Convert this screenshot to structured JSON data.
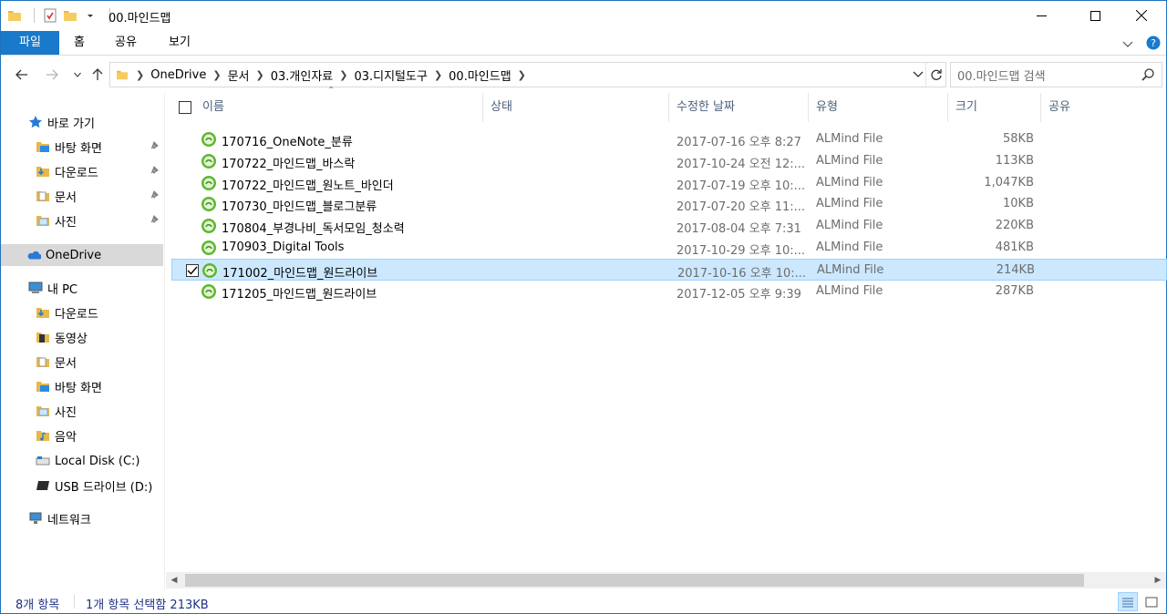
{
  "window": {
    "title": "00.마인드맵",
    "accent": "#1979ca"
  },
  "ribbon": {
    "tabs": [
      {
        "label": "파일"
      },
      {
        "label": "홈"
      },
      {
        "label": "공유"
      },
      {
        "label": "보기"
      }
    ]
  },
  "address": {
    "breadcrumbs": [
      "OneDrive",
      "문서",
      "03.개인자료",
      "03.디지털도구",
      "00.마인드맵"
    ],
    "search_placeholder": "00.마인드맵 검색"
  },
  "nav": {
    "items": [
      {
        "label": "바로 가기",
        "icon": "star-icon"
      },
      {
        "label": "바탕 화면",
        "icon": "folder-blue-icon",
        "pinned": true
      },
      {
        "label": "다운로드",
        "icon": "download-folder-icon",
        "pinned": true
      },
      {
        "label": "문서",
        "icon": "documents-folder-icon",
        "pinned": true
      },
      {
        "label": "사진",
        "icon": "pictures-folder-icon",
        "pinned": true
      },
      {
        "label": "OneDrive",
        "icon": "onedrive-cloud-icon"
      },
      {
        "label": "내 PC",
        "icon": "computer-icon"
      },
      {
        "label": "다운로드",
        "icon": "download-folder-icon"
      },
      {
        "label": "동영상",
        "icon": "videos-folder-icon"
      },
      {
        "label": "문서",
        "icon": "documents-folder-icon"
      },
      {
        "label": "바탕 화면",
        "icon": "folder-blue-icon"
      },
      {
        "label": "사진",
        "icon": "pictures-folder-icon"
      },
      {
        "label": "음악",
        "icon": "music-folder-icon"
      },
      {
        "label": "Local Disk (C:)",
        "icon": "drive-icon"
      },
      {
        "label": "USB 드라이브 (D:)",
        "icon": "usb-drive-icon"
      },
      {
        "label": "네트워크",
        "icon": "network-icon"
      }
    ]
  },
  "columns": {
    "name": "이름",
    "status": "상태",
    "modified": "수정한 날짜",
    "type": "유형",
    "size": "크기",
    "share": "공유"
  },
  "files": [
    {
      "name": "170716_OneNote_분류",
      "modified": "2017-07-16 오후 8:27",
      "type": "ALMind File",
      "size": "58KB",
      "selected": false
    },
    {
      "name": "170722_마인드맵_바스락",
      "modified": "2017-10-24 오전 12:...",
      "type": "ALMind File",
      "size": "113KB",
      "selected": false
    },
    {
      "name": "170722_마인드맵_원노트_바인더",
      "modified": "2017-07-19 오후 10:...",
      "type": "ALMind File",
      "size": "1,047KB",
      "selected": false
    },
    {
      "name": "170730_마인드맵_블로그분류",
      "modified": "2017-07-20 오후 11:...",
      "type": "ALMind File",
      "size": "10KB",
      "selected": false
    },
    {
      "name": "170804_부경나비_독서모임_청소력",
      "modified": "2017-08-04 오후 7:31",
      "type": "ALMind File",
      "size": "220KB",
      "selected": false
    },
    {
      "name": "170903_Digital Tools",
      "modified": "2017-10-29 오후 10:...",
      "type": "ALMind File",
      "size": "481KB",
      "selected": false
    },
    {
      "name": "171002_마인드맵_원드라이브",
      "modified": "2017-10-16 오후 10:...",
      "type": "ALMind File",
      "size": "214KB",
      "selected": true
    },
    {
      "name": "171205_마인드맵_원드라이브",
      "modified": "2017-12-05 오후 9:39",
      "type": "ALMind File",
      "size": "287KB",
      "selected": false
    }
  ],
  "status": {
    "item_count": "8개 항목",
    "selection": "1개 항목 선택함 213KB"
  }
}
